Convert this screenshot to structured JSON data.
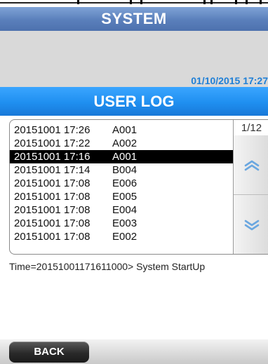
{
  "header": {
    "title": "SYSTEM"
  },
  "info": {
    "datetime": "01/10/2015 17:27"
  },
  "section": {
    "title": "USER LOG"
  },
  "log": {
    "page_indicator": "1/12",
    "rows": [
      {
        "time": "20151001 17:26",
        "code": "A001",
        "selected": false
      },
      {
        "time": "20151001 17:22",
        "code": "A002",
        "selected": false
      },
      {
        "time": "20151001 17:16",
        "code": "A001",
        "selected": true
      },
      {
        "time": "20151001 17:14",
        "code": "B004",
        "selected": false
      },
      {
        "time": "20151001 17:08",
        "code": "E006",
        "selected": false
      },
      {
        "time": "20151001 17:08",
        "code": "E005",
        "selected": false
      },
      {
        "time": "20151001 17:08",
        "code": "E004",
        "selected": false
      },
      {
        "time": "20151001 17:08",
        "code": "E003",
        "selected": false
      },
      {
        "time": "20151001 17:08",
        "code": "E002",
        "selected": false
      }
    ]
  },
  "status": {
    "text": "Time=20151001171611000> System StartUp"
  },
  "footer": {
    "back_label": "BACK"
  },
  "icons": {
    "scroll_up": "double-chevron-up-icon",
    "scroll_down": "double-chevron-down-icon"
  },
  "colors": {
    "system_header": "#5a7fbb",
    "userlog_header": "#1f8ff0",
    "datetime_text": "#1f7fd6",
    "selected_row": "#000000",
    "chevron": "#6aa7e0"
  }
}
